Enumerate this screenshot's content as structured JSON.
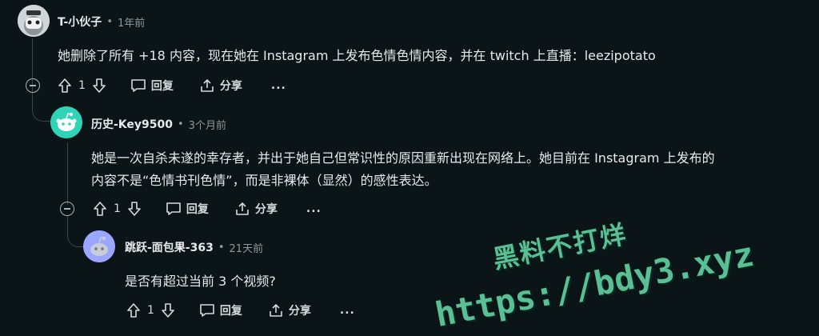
{
  "comments": [
    {
      "user": "T-小伙子",
      "time": "1年前",
      "text": [
        "她删除了所有 +18 内容，现在她在 Instagram 上发布色情色情内容，并在 twitch 上直播：leezipotato"
      ],
      "votes": "1",
      "reply": "回复",
      "share": "分享",
      "more": "..."
    },
    {
      "user": "历史-Key9500",
      "time": "3个月前",
      "text": [
        "她是一次自杀未遂的幸存者，并出于她自己但常识性的原因重新出现在网络上。她目前在 Instagram 上发布的",
        "内容不是“色情书刊色情”，而是非裸体（显然）的感性表达。"
      ],
      "votes": "1",
      "reply": "回复",
      "share": "分享",
      "more": "..."
    },
    {
      "user": "跳跃-面包果-363",
      "time": "21天前",
      "text": [
        "是否有超过当前 3 个视频?"
      ],
      "votes": "1",
      "reply": "回复",
      "share": "分享",
      "more": "..."
    }
  ],
  "watermark": {
    "line1": "黑料不打烊",
    "line2": "https://bdy3.xyz",
    "color": "#5bbf96"
  },
  "colors": {
    "background": "#0b1416",
    "avatar2": "#2fd3b5",
    "avatar3": "#9aa6ff"
  }
}
